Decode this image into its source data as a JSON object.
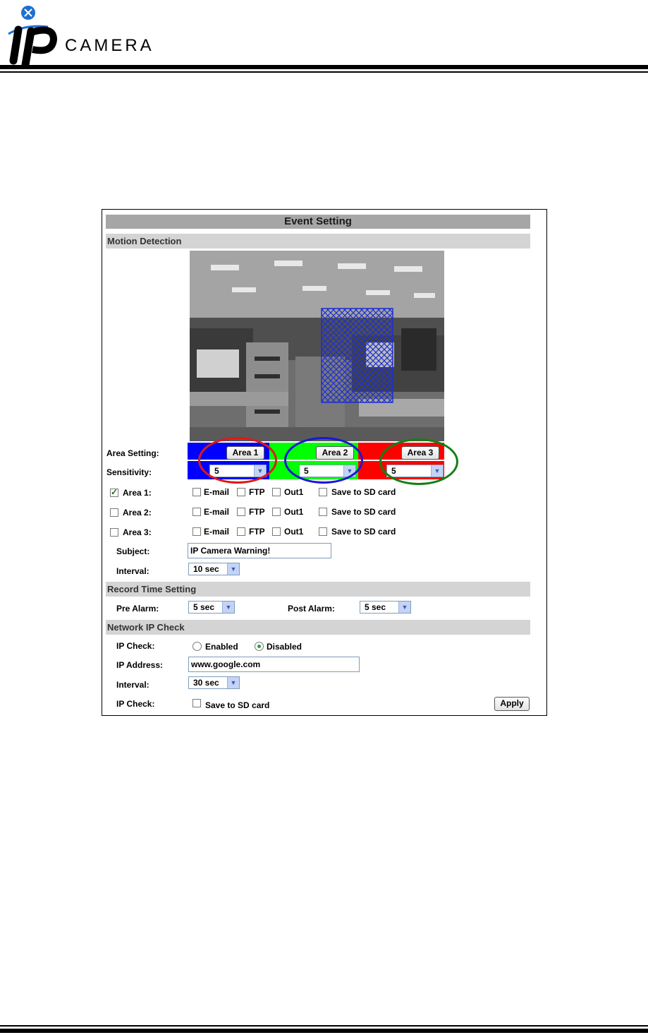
{
  "header": {
    "logo_text": "CAMERA",
    "logo_mark": "ip"
  },
  "panel": {
    "title": "Event Setting",
    "motion_section": "Motion Detection",
    "area_setting_label": "Area Setting:",
    "sensitivity_label": "Sensitivity:",
    "area_buttons": [
      "Area 1",
      "Area 2",
      "Area 3"
    ],
    "sensitivity_values": [
      "5",
      "5",
      "5"
    ],
    "area_colors": [
      "#0000ff",
      "#00ff00",
      "#ff0000"
    ],
    "area_rows": [
      {
        "label": "Area 1:",
        "checked": true
      },
      {
        "label": "Area 2:",
        "checked": false
      },
      {
        "label": "Area 3:",
        "checked": false
      }
    ],
    "action_labels": {
      "email": "E-mail",
      "ftp": "FTP",
      "out1": "Out1",
      "sd": "Save to SD card"
    },
    "subject_label": "Subject:",
    "subject_value": "IP Camera Warning!",
    "interval_label": "Interval:",
    "interval_value": "10 sec",
    "record_section": "Record Time Setting",
    "pre_alarm_label": "Pre Alarm:",
    "pre_alarm_value": "5 sec",
    "post_alarm_label": "Post Alarm:",
    "post_alarm_value": "5 sec",
    "network_section": "Network IP Check",
    "ip_check_label": "IP Check:",
    "enabled_label": "Enabled",
    "disabled_label": "Disabled",
    "ip_check_mode": "Disabled",
    "ip_address_label": "IP Address:",
    "ip_address_value": "www.google.com",
    "net_interval_label": "Interval:",
    "net_interval_value": "30 sec",
    "ip_check2_label": "IP Check:",
    "save_sd_label": "Save to SD card",
    "apply_label": "Apply"
  },
  "annotation_ring_colors": [
    "#e01818",
    "#1818d8",
    "#138013"
  ]
}
